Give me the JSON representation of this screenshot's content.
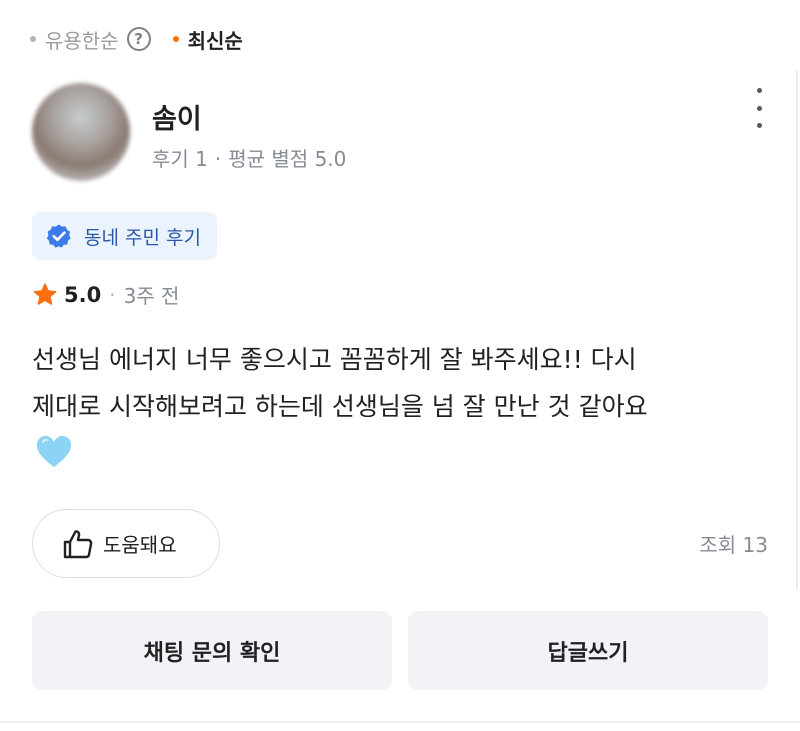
{
  "sort": {
    "options": [
      {
        "label": "유용한순",
        "active": false
      },
      {
        "label": "최신순",
        "active": true
      }
    ],
    "help_icon": "question-circle-icon",
    "help_glyph": "?"
  },
  "reviewer": {
    "name": "솜이",
    "review_count_label": "후기 1",
    "separator": "·",
    "avg_rating_label": "평균 별점 5.0"
  },
  "badge": {
    "label": "동네 주민 후기",
    "icon": "verified-check-icon"
  },
  "rating": {
    "value": "5.0",
    "separator": "·",
    "time_ago": "3주 전"
  },
  "review": {
    "line1": "선생님 에너지 너무 좋으시고 꼼꼼하게 잘 봐주세요!! 다시",
    "line2": "제대로 시작해보려고 하는데 선생님을 넘 잘 만난 것 같아요",
    "emoji": "light-blue-heart-icon"
  },
  "helpful": {
    "label": "도움돼요"
  },
  "views": {
    "label": "조회 13"
  },
  "actions": {
    "chat_label": "채팅 문의 확인",
    "reply_label": "답글쓰기"
  },
  "colors": {
    "accent_orange": "#ff6f0f",
    "badge_blue": "#2a57a7",
    "badge_icon_blue": "#3b7ce8",
    "badge_bg": "#eaf3fe",
    "star": "#ff6f0f",
    "heart": "#8cd3f5"
  }
}
